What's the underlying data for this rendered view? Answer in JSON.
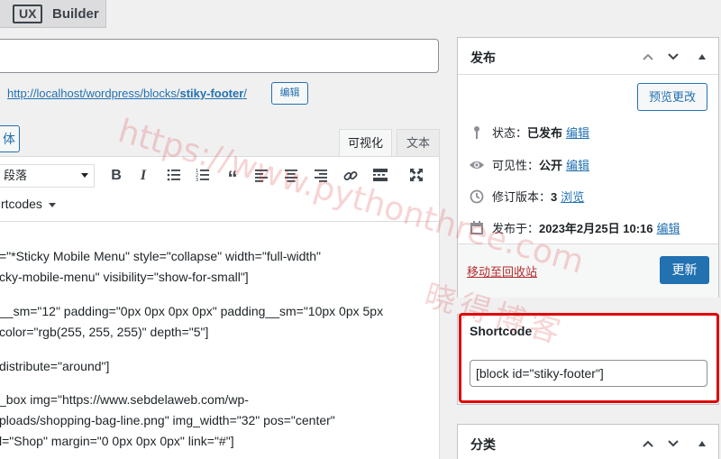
{
  "tab": {
    "badge": "UX",
    "label": "Builder"
  },
  "permalink": {
    "base": "http://localhost/wordpress/blocks/",
    "slug": "stiky-footer",
    "suffix": "/",
    "edit_label": "编辑"
  },
  "media_button": {
    "label": "体"
  },
  "editor_tabs": {
    "visual": "可视化",
    "text": "文本"
  },
  "toolbar": {
    "format": "段落",
    "shortcodes_label": "rtcodes"
  },
  "content_lines": [
    "=\"*Sticky Mobile Menu\" style=\"collapse\" width=\"full-width\"",
    "cky-mobile-menu\" visibility=\"show-for-small\"]",
    "__sm=\"12\" padding=\"0px 0px 0px 0px\" padding__sm=\"10px 0px 5px",
    "color=\"rgb(255, 255, 255)\" depth=\"5\"]",
    " distribute=\"around\"]",
    "_box img=\"https://www.sebdelaweb.com/wp-",
    "ploads/shopping-bag-line.png\" img_width=\"32\" pos=\"center\"",
    "l=\"Shop\" margin=\"0 0px 0px 0px\" link=\"#\"]"
  ],
  "publish": {
    "title": "发布",
    "preview_label": "预览更改",
    "status_label": "状态：",
    "status_value": "已发布",
    "visibility_label": "可见性：",
    "visibility_value": "公开",
    "revisions_label": "修订版本：",
    "revisions_value": "3",
    "revisions_link": "浏览",
    "published_label": "发布于：",
    "published_value": "2023年2月25日 10:16",
    "edit_link": "编辑",
    "trash_label": "移动至回收站",
    "update_label": "更新"
  },
  "shortcode": {
    "title": "Shortcode",
    "value": "[block id=\"stiky-footer\"]"
  },
  "categories": {
    "title": "分类"
  },
  "watermark": {
    "line1": "https://www.pythonthree.com",
    "line2": "晓得博客"
  },
  "colors": {
    "accent": "#2271b1",
    "danger": "#b32d2e",
    "highlight": "#e00000"
  }
}
